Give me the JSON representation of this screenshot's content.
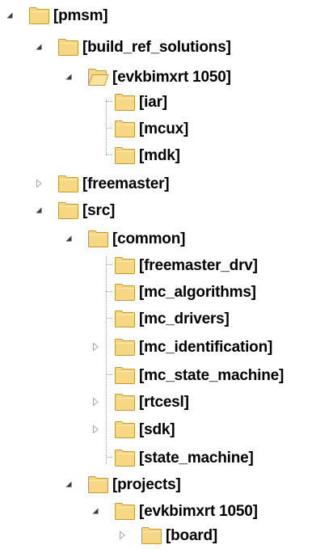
{
  "colors": {
    "folder_fill": "#f6d783",
    "folder_edge": "#c39a32",
    "expander_filled": "#3c3c3c",
    "expander_hollow": "#a6a6a6",
    "connector": "#a0a0a0"
  },
  "icons": {
    "closed_folder": "folder-icon",
    "open_folder": "open-folder-icon",
    "expanded": "expanded-triangle-icon",
    "collapsed": "collapsed-triangle-icon"
  },
  "tree": [
    {
      "id": "pmsm",
      "label": "[pmsm]",
      "state": "expanded",
      "open": false
    },
    {
      "id": "build-ref-solutions",
      "label": "[build_ref_solutions]",
      "state": "expanded",
      "open": false
    },
    {
      "id": "evkbimxrt1050-ref",
      "label": "[evkbimxrt 1050]",
      "state": "expanded",
      "open": true
    },
    {
      "id": "iar",
      "label": "[iar]",
      "state": "leaf",
      "open": false
    },
    {
      "id": "mcux",
      "label": "[mcux]",
      "state": "leaf",
      "open": false
    },
    {
      "id": "mdk",
      "label": "[mdk]",
      "state": "leaf",
      "open": false
    },
    {
      "id": "freemaster",
      "label": "[freemaster]",
      "state": "collapsed",
      "open": false
    },
    {
      "id": "src",
      "label": "[src]",
      "state": "expanded",
      "open": false
    },
    {
      "id": "common",
      "label": "[common]",
      "state": "expanded",
      "open": false
    },
    {
      "id": "freemaster-drv",
      "label": "[freemaster_drv]",
      "state": "leaf",
      "open": false
    },
    {
      "id": "mc-algorithms",
      "label": "[mc_algorithms]",
      "state": "leaf",
      "open": false
    },
    {
      "id": "mc-drivers",
      "label": "[mc_drivers]",
      "state": "leaf",
      "open": false
    },
    {
      "id": "mc-identification",
      "label": "[mc_identification]",
      "state": "collapsed",
      "open": false
    },
    {
      "id": "mc-state-machine",
      "label": "[mc_state_machine]",
      "state": "leaf",
      "open": false
    },
    {
      "id": "rtcesl",
      "label": "[rtcesl]",
      "state": "collapsed",
      "open": false
    },
    {
      "id": "sdk",
      "label": "[sdk]",
      "state": "collapsed",
      "open": false
    },
    {
      "id": "state-machine",
      "label": "[state_machine]",
      "state": "leaf",
      "open": false
    },
    {
      "id": "projects",
      "label": "[projects]",
      "state": "expanded",
      "open": false
    },
    {
      "id": "evkbimxrt1050-proj",
      "label": "[evkbimxrt 1050]",
      "state": "expanded",
      "open": false
    },
    {
      "id": "board",
      "label": "[board]",
      "state": "collapsed",
      "open": false
    }
  ]
}
